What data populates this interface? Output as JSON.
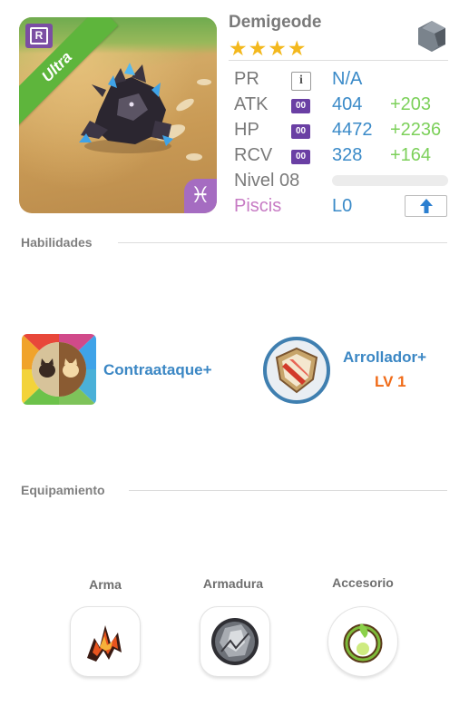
{
  "monster": {
    "name": "Demigeode",
    "rarity_label": "Ultra",
    "rarity_badge": "R",
    "stars": "★★★★",
    "element_icon": "rock-element-icon",
    "sign_glyph": "♓"
  },
  "stats": {
    "pr": {
      "label": "PR",
      "value": "N/A"
    },
    "atk": {
      "label": "ATK",
      "badge": "00",
      "value": "404",
      "bonus": "+203"
    },
    "hp": {
      "label": "HP",
      "badge": "00",
      "value": "4472",
      "bonus": "+2236"
    },
    "rcv": {
      "label": "RCV",
      "badge": "00",
      "value": "328",
      "bonus": "+164"
    },
    "level": {
      "label": "Nivel 08",
      "progress": 0
    },
    "sign": {
      "label": "Piscis",
      "value": "L0"
    }
  },
  "sections": {
    "abilities": "Habilidades",
    "equipment": "Equipamiento"
  },
  "abilities": {
    "active": {
      "name": "Contraataque+"
    },
    "leader": {
      "name": "Arrollador+",
      "level": "LV 1"
    }
  },
  "equipment": [
    {
      "label": "Arma"
    },
    {
      "label": "Armadura"
    },
    {
      "label": "Accesorio"
    }
  ],
  "colors": {
    "accent_blue": "#3a8ac8",
    "bonus_green": "#7cd05a",
    "level_orange": "#f06b18",
    "sign_purple": "#c77bc4",
    "star_gold": "#f3b81d"
  }
}
